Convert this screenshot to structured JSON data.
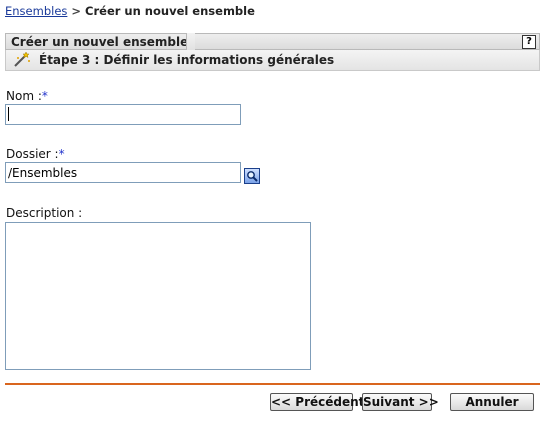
{
  "breadcrumb": {
    "link": "Ensembles",
    "separator": ">",
    "current": "Créer un nouvel ensemble"
  },
  "panel": {
    "title": "Créer un nouvel ensemble",
    "help_label": "?",
    "step_icon": "wizard-wand-icon",
    "step_title": "Étape 3 : Définir les informations générales"
  },
  "form": {
    "name_label": "Nom :",
    "name_required": "*",
    "name_value": "",
    "folder_label": "Dossier :",
    "folder_required": "*",
    "folder_value": "/Ensembles",
    "browse_icon": "magnifier-icon",
    "description_label": "Description :",
    "description_value": ""
  },
  "buttons": {
    "previous": "<< Précédent",
    "next": "Suivant >>",
    "cancel": "Annuler"
  },
  "colors": {
    "link": "#1a3a9a",
    "required": "#2233cc",
    "divider": "#d9651e",
    "input_border": "#7f9db9"
  }
}
